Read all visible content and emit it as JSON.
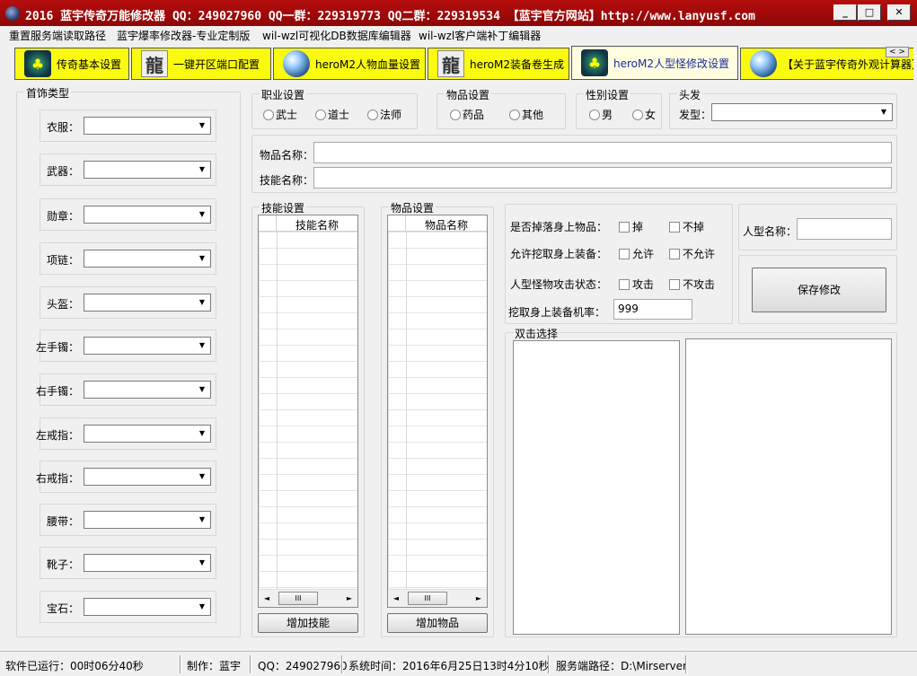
{
  "window": {
    "title": "2016 蓝宇传奇万能修改器  QQ：249027960 QQ一群：229319773 QQ二群：229319534  【蓝宇官方网站】http://www.lanyusf.com"
  },
  "menu": [
    "重置服务端读取路径",
    "蓝宇爆率修改器-专业定制版",
    "wil-wzl可视化DB数据库编辑器",
    "wil-wzl客户端补丁编辑器"
  ],
  "tabs": [
    {
      "label": "传奇基本设置",
      "icon": "tree-icon"
    },
    {
      "label": "一键开区端口配置",
      "icon": "dragon-icon"
    },
    {
      "label": "heroM2人物血量设置",
      "icon": "globe-icon"
    },
    {
      "label": "heroM2装备卷生成",
      "icon": "dragon-icon"
    },
    {
      "label": "heroM2人型怪修改设置",
      "icon": "tree-icon",
      "active": true
    },
    {
      "label": "【关于蓝宇传奇外观计算器】",
      "icon": "globe-icon"
    }
  ],
  "accessories": {
    "title": "首饰类型",
    "items": [
      "衣服：",
      "武器：",
      "勋章：",
      "项链：",
      "头盔：",
      "左手镯：",
      "右手镯：",
      "左戒指：",
      "右戒指：",
      "腰带：",
      "靴子：",
      "宝石："
    ]
  },
  "job": {
    "title": "职业设置",
    "options": [
      "武士",
      "道士",
      "法师"
    ]
  },
  "item_type": {
    "title": "物品设置",
    "options": [
      "药品",
      "其他"
    ]
  },
  "gender": {
    "title": "性别设置",
    "options": [
      "男",
      "女"
    ]
  },
  "hair": {
    "title": "头发",
    "label": "发型："
  },
  "fields": {
    "item_name_label": "物品名称：",
    "skill_name_label": "技能名称："
  },
  "skill_list": {
    "title": "技能设置",
    "column": "技能名称",
    "add_button": "增加技能"
  },
  "item_list": {
    "title": "物品设置",
    "column": "物品名称",
    "add_button": "增加物品"
  },
  "options": {
    "drop_label": "是否掉落身上物品：",
    "drop_yes": "掉",
    "drop_no": "不掉",
    "dig_label": "允许挖取身上装备：",
    "dig_yes": "允许",
    "dig_no": "不允许",
    "attack_label": "人型怪物攻击状态：",
    "attack_yes": "攻击",
    "attack_no": "不攻击",
    "dig_rate_label": "挖取身上装备机率：",
    "dig_rate_value": "999"
  },
  "monster": {
    "name_label": "人型名称：",
    "save_button": "保存修改"
  },
  "double_click": {
    "title": "双击选择"
  },
  "status": {
    "runtime": "软件已运行：00时06分40秒",
    "author": "制作：蓝宇",
    "qq": "QQ：249027960",
    "system_time": "系统时间：2016年6月25日13时4分10秒",
    "server_path": "服务端路径：D:\\Mirserver"
  }
}
